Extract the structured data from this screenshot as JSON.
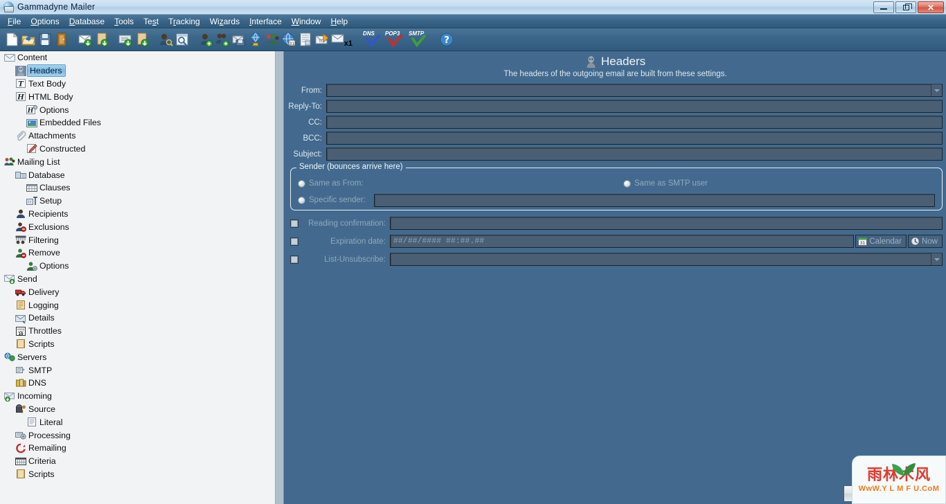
{
  "window": {
    "title": "Gammadyne Mailer",
    "icon": "app-globe-mail-icon",
    "buttons": {
      "minimize": "minimize",
      "maximize": "maximize",
      "close": "close"
    }
  },
  "menubar": {
    "items": [
      {
        "label": "File",
        "accel": "F"
      },
      {
        "label": "Options",
        "accel": "O"
      },
      {
        "label": "Database",
        "accel": "D"
      },
      {
        "label": "Tools",
        "accel": "T"
      },
      {
        "label": "Test",
        "accel": "s"
      },
      {
        "label": "Tracking",
        "accel": "r"
      },
      {
        "label": "Wizards",
        "accel": "z"
      },
      {
        "label": "Interface",
        "accel": "I"
      },
      {
        "label": "Window",
        "accel": "W"
      },
      {
        "label": "Help",
        "accel": "H"
      }
    ]
  },
  "toolbar": {
    "items": [
      {
        "name": "new-document-icon",
        "tip": "New"
      },
      {
        "name": "open-folder-icon",
        "tip": "Open"
      },
      {
        "name": "save-floppy-icon",
        "tip": "Save"
      },
      {
        "name": "exit-door-icon",
        "tip": "Exit"
      },
      {
        "name": "import-mail-icon",
        "tip": "Import Message"
      },
      {
        "name": "import-scroll-icon",
        "tip": "Import Script"
      },
      {
        "name": "export-card-icon",
        "tip": "Export Card"
      },
      {
        "name": "export-scroll-icon",
        "tip": "Export Script"
      },
      {
        "name": "user-search-icon",
        "tip": "Find Recipient"
      },
      {
        "name": "preview-magnifier-icon",
        "tip": "Preview"
      },
      {
        "name": "add-user-icon",
        "tip": "Add Recipient"
      },
      {
        "name": "add-users-icon",
        "tip": "Add Recipients"
      },
      {
        "name": "remove-users-icon",
        "tip": "Remove Recipients"
      },
      {
        "name": "save-mail-icon",
        "tip": "Save Message"
      },
      {
        "name": "globe-lamp-icon",
        "tip": "Web Lookup"
      },
      {
        "name": "group-users-icon",
        "tip": "Mailing List"
      },
      {
        "name": "globe-calendar-icon",
        "tip": "Schedule"
      },
      {
        "name": "report-icon",
        "tip": "Statistics"
      },
      {
        "name": "send-to-mail-icon",
        "tip": "Send"
      },
      {
        "name": "send-one-mail-icon",
        "tip": "Send One",
        "badge": "x1"
      },
      {
        "name": "dns-check-icon",
        "tip": "DNS",
        "mini": "DNS"
      },
      {
        "name": "pop3-check-icon",
        "tip": "POP3",
        "mini": "POP3"
      },
      {
        "name": "smtp-check-icon",
        "tip": "SMTP",
        "mini": "SMTP"
      },
      {
        "name": "help-question-icon",
        "tip": "Help"
      }
    ],
    "badge_x1": "x1",
    "mini_dns": "DNS",
    "mini_pop3": "POP3",
    "mini_smtp": "SMTP"
  },
  "sidebar": {
    "items": [
      {
        "label": "Content",
        "indent": 0,
        "icon": "envelope-content-icon",
        "selected": false
      },
      {
        "label": "Headers",
        "indent": 1,
        "icon": "head-bust-icon",
        "selected": true
      },
      {
        "label": "Text Body",
        "indent": 1,
        "icon": "text-t-icon",
        "selected": false
      },
      {
        "label": "HTML Body",
        "indent": 1,
        "icon": "html-h-icon",
        "selected": false
      },
      {
        "label": "Options",
        "indent": 2,
        "icon": "html-options-icon",
        "selected": false
      },
      {
        "label": "Embedded Files",
        "indent": 2,
        "icon": "picture-icon",
        "selected": false
      },
      {
        "label": "Attachments",
        "indent": 1,
        "icon": "paperclip-icon",
        "selected": false
      },
      {
        "label": "Constructed",
        "indent": 2,
        "icon": "pencil-page-icon",
        "selected": false
      },
      {
        "label": "Mailing List",
        "indent": 0,
        "icon": "people-group-icon",
        "selected": false
      },
      {
        "label": "Database",
        "indent": 1,
        "icon": "database-grid-icon",
        "selected": false
      },
      {
        "label": "Clauses",
        "indent": 2,
        "icon": "table-clauses-icon",
        "selected": false
      },
      {
        "label": "Setup",
        "indent": 2,
        "icon": "setup-ruler-icon",
        "selected": false
      },
      {
        "label": "Recipients",
        "indent": 1,
        "icon": "user-icon",
        "selected": false
      },
      {
        "label": "Exclusions",
        "indent": 1,
        "icon": "user-minus-icon",
        "selected": false
      },
      {
        "label": "Filtering",
        "indent": 1,
        "icon": "filter-grid-icon",
        "selected": false
      },
      {
        "label": "Remove",
        "indent": 1,
        "icon": "user-remove-icon",
        "selected": false
      },
      {
        "label": "Options",
        "indent": 2,
        "icon": "user-gear-icon",
        "selected": false
      },
      {
        "label": "Send",
        "indent": 0,
        "icon": "send-envelope-icon",
        "selected": false
      },
      {
        "label": "Delivery",
        "indent": 1,
        "icon": "truck-icon",
        "selected": false
      },
      {
        "label": "Logging",
        "indent": 1,
        "icon": "log-scroll-icon",
        "selected": false
      },
      {
        "label": "Details",
        "indent": 1,
        "icon": "details-mail-icon",
        "selected": false
      },
      {
        "label": "Throttles",
        "indent": 1,
        "icon": "speed-limit-icon",
        "selected": false
      },
      {
        "label": "Scripts",
        "indent": 1,
        "icon": "script-scroll-icon",
        "selected": false
      },
      {
        "label": "Servers",
        "indent": 0,
        "icon": "servers-globe-icon",
        "selected": false
      },
      {
        "label": "SMTP",
        "indent": 1,
        "icon": "smtp-server-icon",
        "selected": false
      },
      {
        "label": "DNS",
        "indent": 1,
        "icon": "dns-books-icon",
        "selected": false
      },
      {
        "label": "Incoming",
        "indent": 0,
        "icon": "incoming-mail-icon",
        "selected": false
      },
      {
        "label": "Source",
        "indent": 1,
        "icon": "mailbox-icon",
        "selected": false
      },
      {
        "label": "Literal",
        "indent": 2,
        "icon": "literal-page-icon",
        "selected": false
      },
      {
        "label": "Processing",
        "indent": 1,
        "icon": "processing-gear-icon",
        "selected": false
      },
      {
        "label": "Remailing",
        "indent": 1,
        "icon": "remail-refresh-icon",
        "selected": false
      },
      {
        "label": "Criteria",
        "indent": 1,
        "icon": "criteria-grid-icon",
        "selected": false
      },
      {
        "label": "Scripts",
        "indent": 1,
        "icon": "script-scroll-icon",
        "selected": false
      }
    ]
  },
  "main": {
    "title": "Headers",
    "title_icon": "head-bust-icon",
    "subtitle": "The headers of the outgoing email are built from these settings.",
    "fields": [
      {
        "label": "From:",
        "value": "",
        "placeholder": "",
        "dropdown": true
      },
      {
        "label": "Reply-To:",
        "value": "",
        "placeholder": "",
        "dropdown": false
      },
      {
        "label": "CC:",
        "value": "",
        "placeholder": "",
        "dropdown": false
      },
      {
        "label": "BCC:",
        "value": "",
        "placeholder": "",
        "dropdown": false
      },
      {
        "label": "Subject:",
        "value": "",
        "placeholder": "",
        "dropdown": false
      }
    ],
    "sender_group": {
      "legend": "Sender (bounces arrive here)",
      "option_same_as_from": "Same as From:",
      "option_same_as_smtp": "Same as SMTP user",
      "option_specific": "Specific sender:",
      "specific_value": "",
      "selected": "none"
    },
    "extras": {
      "reading_confirmation_label": "Reading confirmation:",
      "reading_confirmation_value": "",
      "reading_confirmation_checked": false,
      "expiration_label": "Expiration date:",
      "expiration_value": "",
      "expiration_placeholder": "##/##/#### ##:##.##",
      "expiration_checked": false,
      "calendar_button": "Calendar",
      "calendar_icon": "calendar-icon",
      "now_button": "Now",
      "now_icon": "clock-icon",
      "list_unsubscribe_label": "List-Unsubscribe:",
      "list_unsubscribe_value": "",
      "list_unsubscribe_checked": false
    },
    "bottom_button": {
      "label": "",
      "icon": "head-bust-icon"
    }
  },
  "watermark": {
    "chinese": "雨林木风",
    "url": "WwW.Y L M F U.CoM",
    "leaf_icon": "sprout-leaf-icon"
  },
  "colors": {
    "panel_bg": "#436a8e",
    "sidebar_bg": "#f2f3f5",
    "input_bg": "#4b5f74",
    "menubar_bg": "#3a6588",
    "selection": "#7fb9e4",
    "accent_text": "#eef4f9",
    "watermark_red": "#e23b2e",
    "watermark_orange": "#f07a1a"
  }
}
